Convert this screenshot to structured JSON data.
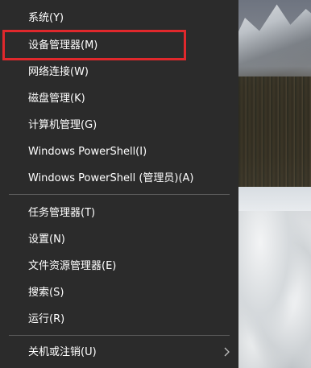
{
  "menu": {
    "items": [
      {
        "label": "系统(Y)"
      },
      {
        "label": "设备管理器(M)"
      },
      {
        "label": "网络连接(W)"
      },
      {
        "label": "磁盘管理(K)"
      },
      {
        "label": "计算机管理(G)"
      },
      {
        "label": "Windows PowerShell(I)"
      },
      {
        "label": "Windows PowerShell (管理员)(A)"
      },
      {
        "label": "任务管理器(T)"
      },
      {
        "label": "设置(N)"
      },
      {
        "label": "文件资源管理器(E)"
      },
      {
        "label": "搜索(S)"
      },
      {
        "label": "运行(R)"
      },
      {
        "label": "关机或注销(U)",
        "icon": "chevron-right-icon"
      }
    ],
    "highlighted_item": "设备管理器(M)",
    "colors": {
      "background": "#2b2b2b",
      "text": "#ffffff",
      "separator": "#5a5a5a",
      "highlight_border": "#e0282c"
    }
  }
}
